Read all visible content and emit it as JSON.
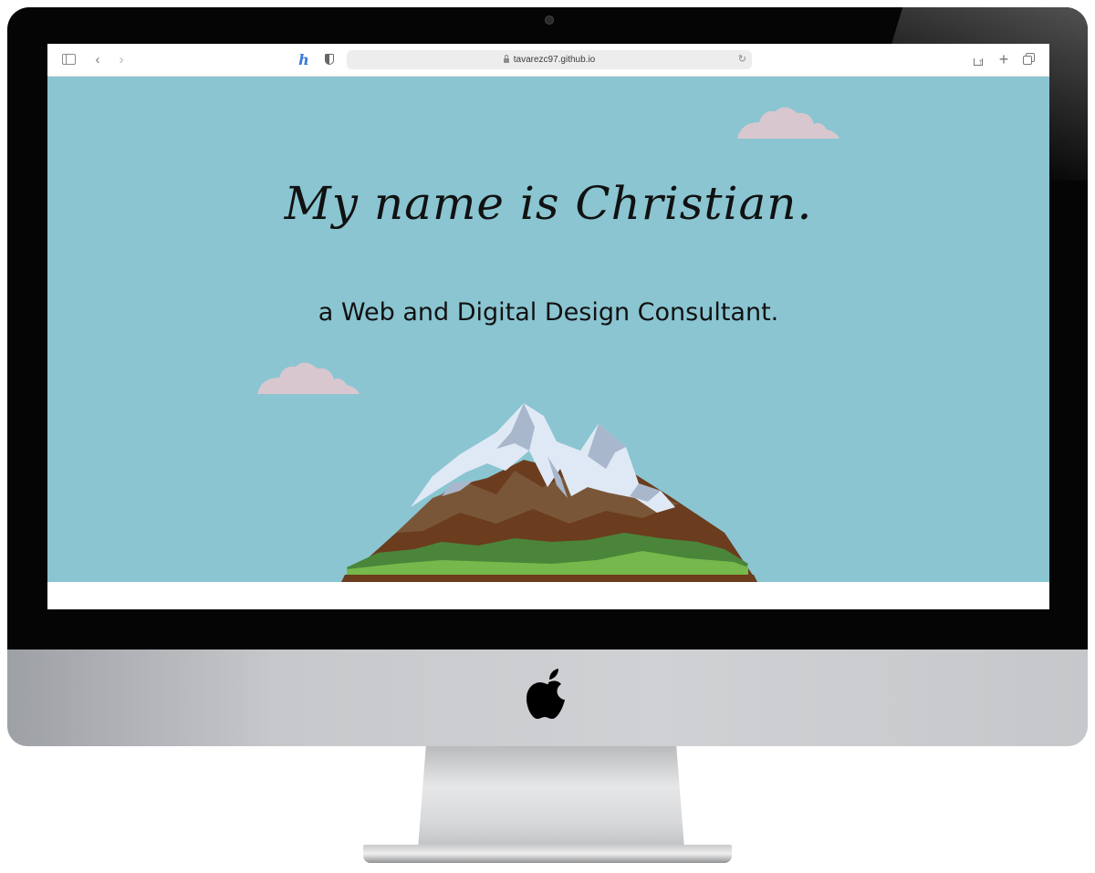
{
  "browser": {
    "url": "tavarezc97.github.io",
    "back_icon": "‹",
    "forward_icon": "›",
    "extension_icon_glyph": "ℎ",
    "reload_icon": "↻",
    "newtab_icon": "+"
  },
  "hero": {
    "headline": "My name is Christian.",
    "subheadline": "a Web and Digital Design Consultant."
  },
  "colors": {
    "sky": "#8ac5d1",
    "cloud": "#d8c7cf",
    "snow": "#dfe9f5",
    "snow_shadow": "#a9b7cc",
    "rock_light": "#7a5638",
    "rock_dark": "#6b3c1e",
    "grass_dark": "#4a853a",
    "grass_light": "#76b84b"
  },
  "icons": [
    "sidebar-icon",
    "back-icon",
    "forward-icon",
    "extension-icon",
    "shield-icon",
    "lock-icon",
    "reload-icon",
    "share-icon",
    "new-tab-icon",
    "tabs-overview-icon",
    "apple-logo"
  ]
}
